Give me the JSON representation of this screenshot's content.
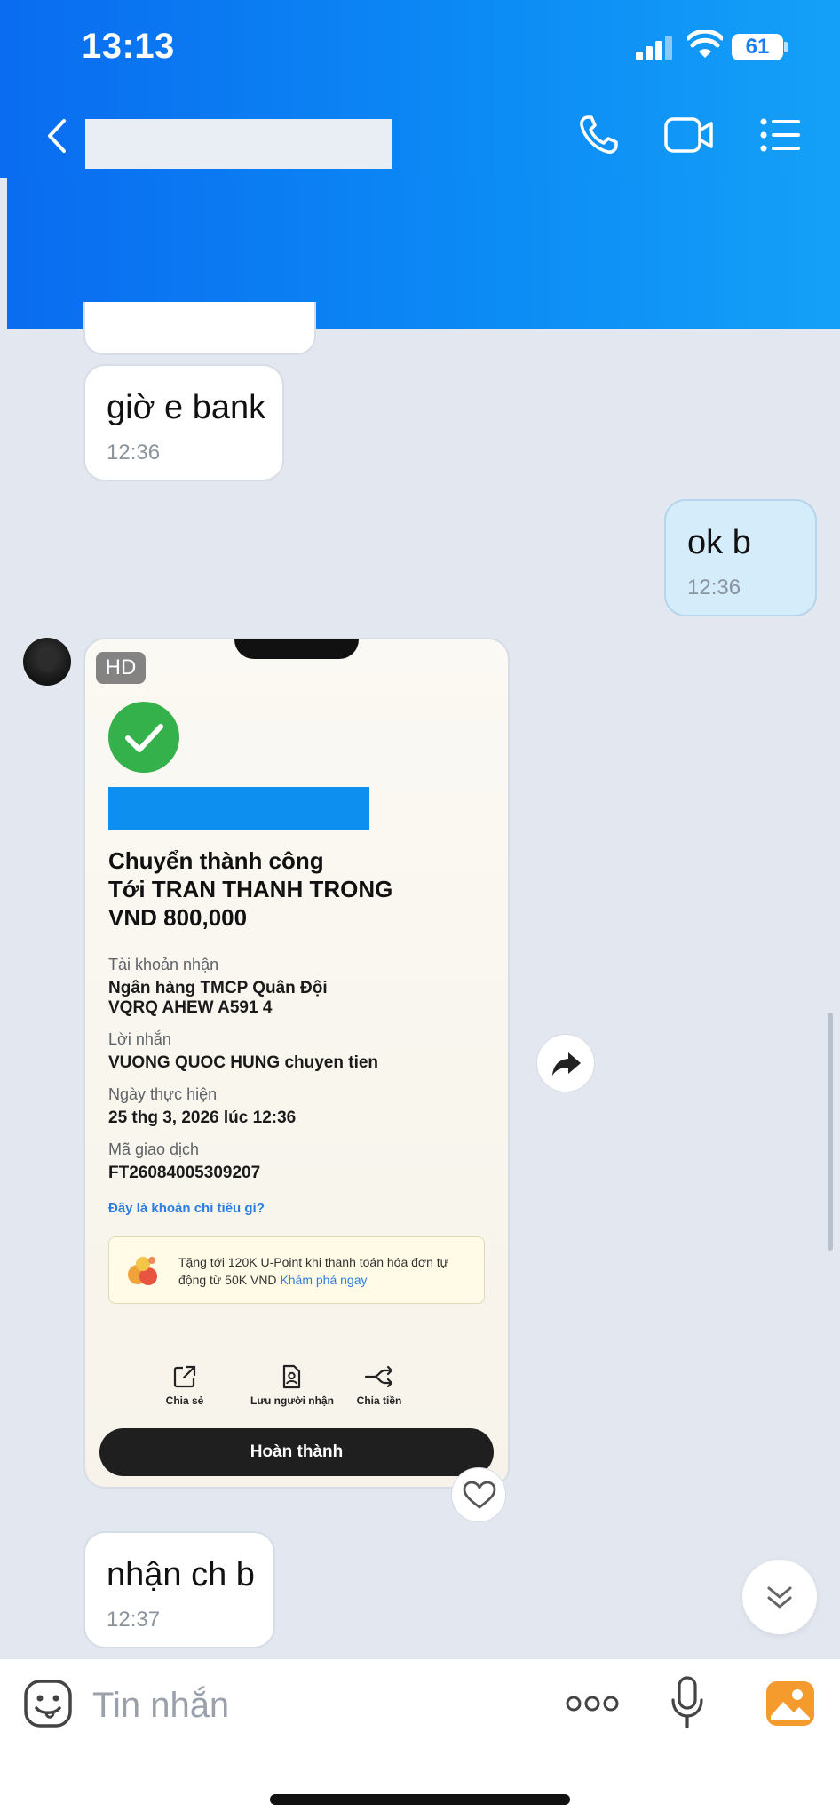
{
  "status_bar": {
    "time": "13:13",
    "battery": "61"
  },
  "header": {
    "back_icon": "chevron-left-icon",
    "call_icon": "phone-icon",
    "video_icon": "video-camera-icon",
    "menu_icon": "list-icon"
  },
  "messages": [
    {
      "text": "giờ e bank",
      "time": "12:36",
      "direction": "in"
    },
    {
      "text": "ok b",
      "time": "12:36",
      "direction": "out"
    },
    {
      "text": "nhận ch b",
      "time": "12:37",
      "direction": "in"
    }
  ],
  "screenshot": {
    "badge": "HD",
    "title_lines": [
      "Chuyển thành công",
      "Tới TRAN THANH TRONG",
      "VND 800,000"
    ],
    "account_label": "Tài khoản nhận",
    "account_value_lines": [
      "Ngân hàng TMCP Quân Đội",
      "VQRQ AHEW A591 4"
    ],
    "message_label": "Lời nhắn",
    "message_value": "VUONG QUOC HUNG chuyen tien",
    "date_label": "Ngày thực hiện",
    "date_value": "25 thg 3, 2026 lúc 12:36",
    "txn_label": "Mã giao dịch",
    "txn_value": "FT26084005309207",
    "spending_link": "Đây là khoản chi tiêu gì?",
    "promo_text": "Tặng tới 120K U-Point khi thanh toán hóa đơn tự động từ 50K VND ",
    "promo_cta": "Khám phá ngay",
    "actions": [
      {
        "label": "Chia sẻ",
        "icon": "share-external-icon"
      },
      {
        "label": "Lưu người nhận",
        "icon": "contact-save-icon"
      },
      {
        "label": "Chia tiền",
        "icon": "split-arrows-icon"
      }
    ],
    "done_button": "Hoàn thành"
  },
  "composer": {
    "placeholder": "Tin nhắn"
  },
  "colors": {
    "header_blue": "#0c8cf5",
    "outgoing_bubble": "#d5ecfb",
    "success_green": "#34b14a",
    "link_blue": "#2a7de1"
  }
}
